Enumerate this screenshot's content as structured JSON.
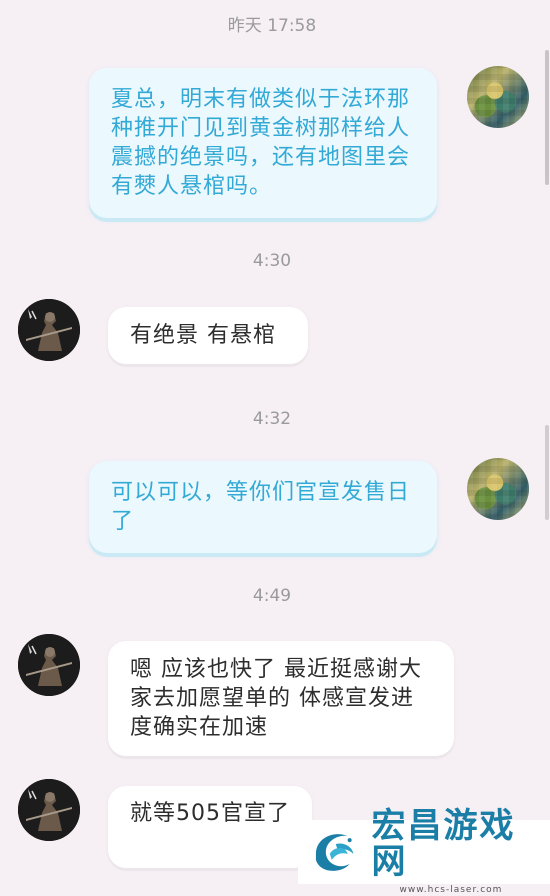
{
  "messages": {
    "ts1": "昨天 17:58",
    "m1": "夏总，明末有做类似于法环那种推开门见到黄金树那样给人震撼的绝景吗，还有地图里会有僰人悬棺吗。",
    "ts2": "4:30",
    "m2": "有绝景  有悬棺",
    "ts3": "4:32",
    "m3": "可以可以，等你们官宣发售日了",
    "ts4": "4:49",
    "m4": "嗯 应该也快了  最近挺感谢大家去加愿望单的   体感宣发进度确实在加速",
    "m5": "就等505官宣了"
  },
  "watermark": {
    "title": "宏昌游戏网",
    "url": "www.hcs-laser.com"
  },
  "avatars": {
    "self": "user-avatar",
    "other": "developer-avatar"
  },
  "colors": {
    "background": "#f6f0f5",
    "self_bubble": "#ebf8fd",
    "self_text": "#33a9d6",
    "other_bubble": "#ffffff",
    "other_text": "#2d2d2d",
    "timestamp": "#9a9a9a"
  }
}
